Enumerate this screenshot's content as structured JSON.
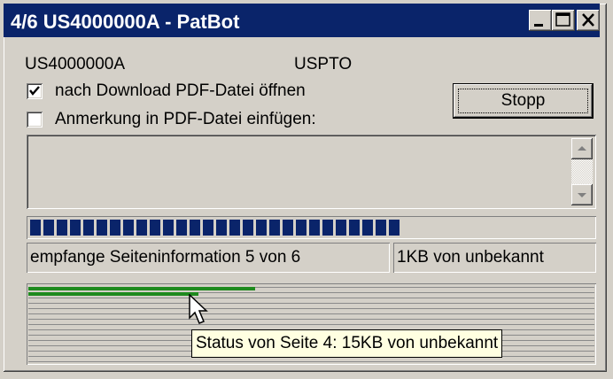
{
  "window": {
    "title": "4/6 US4000000A - PatBot",
    "controls": [
      "minimize-icon",
      "maximize-icon",
      "close-icon"
    ]
  },
  "info": {
    "patent_number": "US4000000A",
    "office": "USPTO"
  },
  "options": {
    "open_pdf": {
      "label": "nach Download PDF-Datei öffnen",
      "checked": true
    },
    "add_note": {
      "label": "Anmerkung in PDF-Datei einfügen:",
      "checked": false
    }
  },
  "actions": {
    "stop_label": "Stopp"
  },
  "note_area": {
    "value": ""
  },
  "progress": {
    "fraction": 0.67
  },
  "status": {
    "message": "empfange Seiteninformation 5 von 6",
    "size": "1KB von unbekannt"
  },
  "pages": {
    "bars": [
      0.4,
      0.3
    ],
    "tooltip": "Status von Seite 4: 15KB von unbekannt"
  },
  "colors": {
    "title_bar": "#0a246a",
    "progress": "#0a246a",
    "page_bar": "#1e8a1e",
    "tooltip_bg": "#ffffe1"
  }
}
